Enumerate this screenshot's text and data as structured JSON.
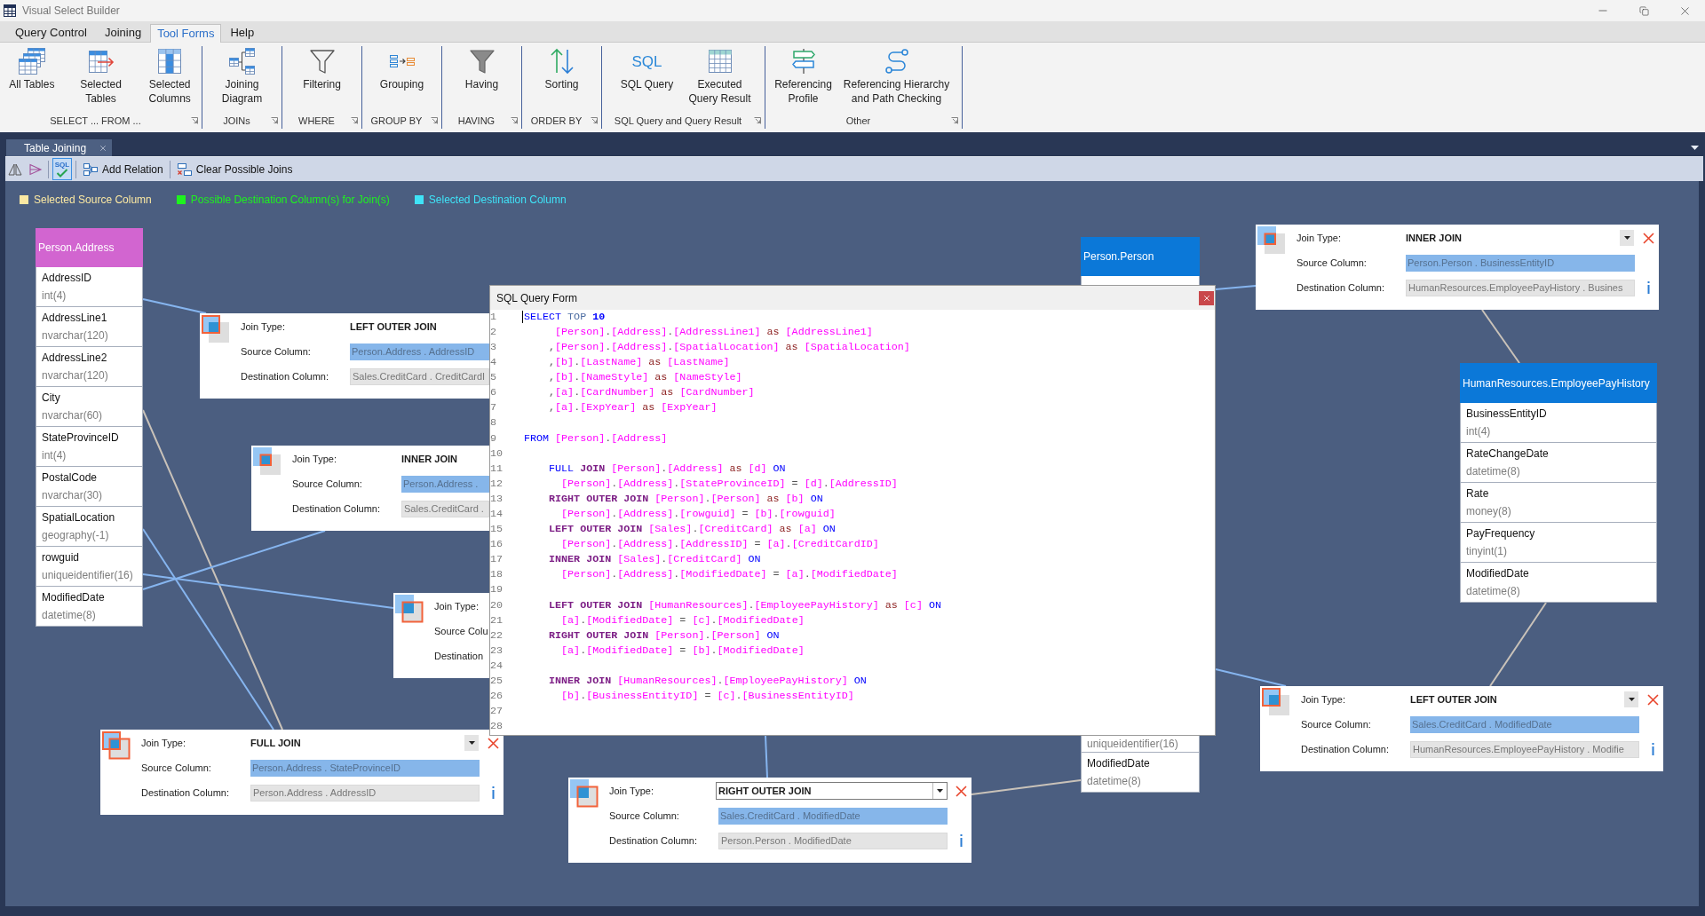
{
  "window": {
    "title": "Visual Select Builder"
  },
  "menu_tabs": [
    {
      "label": "Query Control",
      "selected": false
    },
    {
      "label": "Joining",
      "selected": false
    },
    {
      "label": "Tool Forms",
      "selected": true
    },
    {
      "label": "Help",
      "selected": false
    }
  ],
  "ribbon": [
    {
      "label": "SELECT ... FROM ...",
      "buttons": [
        {
          "kind": "all_tables",
          "label": "All Tables"
        },
        {
          "kind": "selected_tables",
          "label": "Selected Tables"
        },
        {
          "kind": "selected_columns",
          "label": "Selected Columns"
        }
      ]
    },
    {
      "label": "JOINs",
      "buttons": [
        {
          "kind": "joining_diagram",
          "label": "Joining Diagram"
        }
      ]
    },
    {
      "label": "WHERE",
      "buttons": [
        {
          "kind": "filtering",
          "label": "Filtering"
        }
      ]
    },
    {
      "label": "GROUP BY",
      "buttons": [
        {
          "kind": "grouping",
          "label": "Grouping"
        }
      ]
    },
    {
      "label": "HAVING",
      "buttons": [
        {
          "kind": "having",
          "label": "Having"
        }
      ]
    },
    {
      "label": "ORDER BY",
      "buttons": [
        {
          "kind": "sorting",
          "label": "Sorting"
        }
      ]
    },
    {
      "label": "SQL Query and Query Result",
      "buttons": [
        {
          "kind": "sql_query",
          "icon_text": "SQL",
          "label": "SQL Query"
        },
        {
          "kind": "executed_result",
          "label": "Executed Query Result"
        }
      ]
    },
    {
      "label": "Other",
      "buttons": [
        {
          "kind": "referencing_profile",
          "label": "Referencing Profile"
        },
        {
          "kind": "referencing_hierarchy",
          "label": "Referencing Hierarchy and Path Checking"
        }
      ]
    }
  ],
  "document_tab": {
    "label": "Table Joining"
  },
  "toolbar": [
    {
      "kind": "mirror",
      "pressed": false
    },
    {
      "kind": "triangle",
      "pressed": false
    },
    {
      "kind": "sql_check",
      "icon_text": "SQL",
      "pressed": true
    },
    {
      "kind": "add_relation",
      "label": "Add Relation",
      "pressed": false
    },
    {
      "kind": "clear_joins",
      "label": "Clear Possible Joins",
      "pressed": false
    }
  ],
  "legend": [
    {
      "label": "Selected Source Column",
      "color": "#fbe8a2"
    },
    {
      "label": "Possible Destination Column(s) for Join(s)",
      "color": "#1ef21e"
    },
    {
      "label": "Selected Destination Column",
      "color": "#3fe3f7"
    }
  ],
  "tables": [
    {
      "name": "Person.Address",
      "color": "#d265d0",
      "columns": [
        {
          "name": "AddressID",
          "type": "int(4)"
        },
        {
          "name": "AddressLine1",
          "type": "nvarchar(120)"
        },
        {
          "name": "AddressLine2",
          "type": "nvarchar(120)"
        },
        {
          "name": "City",
          "type": "nvarchar(60)"
        },
        {
          "name": "StateProvinceID",
          "type": "int(4)"
        },
        {
          "name": "PostalCode",
          "type": "nvarchar(30)"
        },
        {
          "name": "SpatialLocation",
          "type": "geography(-1)"
        },
        {
          "name": "rowguid",
          "type": "uniqueidentifier(16)"
        },
        {
          "name": "ModifiedDate",
          "type": "datetime(8)"
        }
      ]
    },
    {
      "name": "Person.Person",
      "color": "#0b78d8",
      "columns": [
        {
          "type": "uniqueidentifier(16)"
        },
        {
          "name": "ModifiedDate",
          "type": "datetime(8)"
        }
      ]
    },
    {
      "name": "HumanResources.EmployeePayHistory",
      "color": "#0b78d8",
      "columns": [
        {
          "name": "BusinessEntityID",
          "type": "int(4)"
        },
        {
          "name": "RateChangeDate",
          "type": "datetime(8)"
        },
        {
          "name": "Rate",
          "type": "money(8)"
        },
        {
          "name": "PayFrequency",
          "type": "tinyint(1)"
        },
        {
          "name": "ModifiedDate",
          "type": "datetime(8)"
        }
      ]
    }
  ],
  "join_cards": [
    {
      "kind": "inner",
      "join_type_label": "Join Type:",
      "join_type": "INNER JOIN",
      "focused": false,
      "source_label": "Source Column:",
      "source": "Person.Person . BusinessEntityID",
      "destination_label": "Destination Column:",
      "destination": "HumanResources.EmployeePayHistory . Busines"
    },
    {
      "kind": "left",
      "join_type_label": "Join Type:",
      "join_type": "LEFT OUTER JOIN",
      "source_label": "Source Column:",
      "source": "Person.Address . AddressID",
      "destination_label": "Destination Column:",
      "destination": "Sales.CreditCard . CreditCardI"
    },
    {
      "kind": "inner",
      "join_type_label": "Join Type:",
      "join_type": "INNER JOIN",
      "source_label": "Source Column:",
      "source": "Person.Address .",
      "destination_label": "Destination Column:",
      "destination": "Sales.CreditCard ."
    },
    {
      "kind": "right",
      "join_type_label": "Join Type:",
      "source_label": "Source Colu",
      "destination_label": "Destination"
    },
    {
      "kind": "left",
      "join_type_label": "Join Type:",
      "join_type": "LEFT OUTER JOIN",
      "focused": false,
      "source_label": "Source Column:",
      "source": "Sales.CreditCard . ModifiedDate",
      "destination_label": "Destination Column:",
      "destination": "HumanResources.EmployeePayHistory . Modifie"
    },
    {
      "kind": "full",
      "join_type_label": "Join Type:",
      "join_type": "FULL JOIN",
      "focused": false,
      "source_label": "Source Column:",
      "source": "Person.Address . StateProvinceID",
      "destination_label": "Destination Column:",
      "destination": "Person.Address . AddressID"
    },
    {
      "kind": "right",
      "join_type_label": "Join Type:",
      "join_type": "RIGHT OUTER JOIN",
      "focused": true,
      "source_label": "Source Column:",
      "source": "Sales.CreditCard . ModifiedDate",
      "destination_label": "Destination Column:",
      "destination": "Person.Person . ModifiedDate"
    }
  ],
  "sql_form": {
    "title": "SQL Query Form",
    "lines": [
      {
        "number": "1",
        "tokens": [
          {
            "kind": "keyword",
            "text": "SELECT "
          },
          {
            "kind": "keyword_dim",
            "text": "TOP "
          },
          {
            "kind": "number",
            "text": "10"
          }
        ]
      },
      {
        "number": "2",
        "tokens": [
          {
            "kind": "name",
            "text": "     [Person]"
          },
          {
            "kind": "punct",
            "text": "."
          },
          {
            "kind": "name",
            "text": "[Address]"
          },
          {
            "kind": "punct",
            "text": "."
          },
          {
            "kind": "name",
            "text": "[AddressLine1]"
          },
          {
            "kind": "alias",
            "text": " as "
          },
          {
            "kind": "name",
            "text": "[AddressLine1]"
          }
        ]
      },
      {
        "number": "3",
        "tokens": [
          {
            "kind": "punct",
            "text": "    ,"
          },
          {
            "kind": "name",
            "text": "[Person]"
          },
          {
            "kind": "punct",
            "text": "."
          },
          {
            "kind": "name",
            "text": "[Address]"
          },
          {
            "kind": "punct",
            "text": "."
          },
          {
            "kind": "name",
            "text": "[SpatialLocation]"
          },
          {
            "kind": "alias",
            "text": " as "
          },
          {
            "kind": "name",
            "text": "[SpatialLocation]"
          }
        ]
      },
      {
        "number": "4",
        "tokens": [
          {
            "kind": "punct",
            "text": "    ,"
          },
          {
            "kind": "name",
            "text": "[b]"
          },
          {
            "kind": "punct",
            "text": "."
          },
          {
            "kind": "name",
            "text": "[LastName]"
          },
          {
            "kind": "alias",
            "text": " as "
          },
          {
            "kind": "name",
            "text": "[LastName]"
          }
        ]
      },
      {
        "number": "5",
        "tokens": [
          {
            "kind": "punct",
            "text": "    ,"
          },
          {
            "kind": "name",
            "text": "[b]"
          },
          {
            "kind": "punct",
            "text": "."
          },
          {
            "kind": "name",
            "text": "[NameStyle]"
          },
          {
            "kind": "alias",
            "text": " as "
          },
          {
            "kind": "name",
            "text": "[NameStyle]"
          }
        ]
      },
      {
        "number": "6",
        "tokens": [
          {
            "kind": "punct",
            "text": "    ,"
          },
          {
            "kind": "name",
            "text": "[a]"
          },
          {
            "kind": "punct",
            "text": "."
          },
          {
            "kind": "name",
            "text": "[CardNumber]"
          },
          {
            "kind": "alias",
            "text": " as "
          },
          {
            "kind": "name",
            "text": "[CardNumber]"
          }
        ]
      },
      {
        "number": "7",
        "tokens": [
          {
            "kind": "punct",
            "text": "    ,"
          },
          {
            "kind": "name",
            "text": "[a]"
          },
          {
            "kind": "punct",
            "text": "."
          },
          {
            "kind": "name",
            "text": "[ExpYear]"
          },
          {
            "kind": "alias",
            "text": " as "
          },
          {
            "kind": "name",
            "text": "[ExpYear]"
          }
        ]
      },
      {
        "number": "8"
      },
      {
        "number": "9",
        "tokens": [
          {
            "kind": "keyword",
            "text": "FROM "
          },
          {
            "kind": "name",
            "text": "[Person]"
          },
          {
            "kind": "punct",
            "text": "."
          },
          {
            "kind": "name",
            "text": "[Address]"
          }
        ]
      },
      {
        "number": "10"
      },
      {
        "number": "11",
        "tokens": [
          {
            "kind": "keyword",
            "text": "    FULL "
          },
          {
            "kind": "join",
            "text": "JOIN "
          },
          {
            "kind": "name",
            "text": "[Person]"
          },
          {
            "kind": "punct",
            "text": "."
          },
          {
            "kind": "name",
            "text": "[Address]"
          },
          {
            "kind": "alias",
            "text": " as "
          },
          {
            "kind": "name",
            "text": "[d]"
          },
          {
            "kind": "keyword",
            "text": " ON"
          }
        ]
      },
      {
        "number": "12",
        "tokens": [
          {
            "kind": "name",
            "text": "      [Person]"
          },
          {
            "kind": "punct",
            "text": "."
          },
          {
            "kind": "name",
            "text": "[Address]"
          },
          {
            "kind": "punct",
            "text": "."
          },
          {
            "kind": "name",
            "text": "[StateProvinceID]"
          },
          {
            "kind": "punct",
            "text": " = "
          },
          {
            "kind": "name",
            "text": "[d]"
          },
          {
            "kind": "punct",
            "text": "."
          },
          {
            "kind": "name",
            "text": "[AddressID]"
          }
        ]
      },
      {
        "number": "13",
        "tokens": [
          {
            "kind": "join",
            "text": "    RIGHT OUTER JOIN "
          },
          {
            "kind": "name",
            "text": "[Person]"
          },
          {
            "kind": "punct",
            "text": "."
          },
          {
            "kind": "name",
            "text": "[Person]"
          },
          {
            "kind": "alias",
            "text": " as "
          },
          {
            "kind": "name",
            "text": "[b]"
          },
          {
            "kind": "keyword",
            "text": " ON"
          }
        ]
      },
      {
        "number": "14",
        "tokens": [
          {
            "kind": "name",
            "text": "      [Person]"
          },
          {
            "kind": "punct",
            "text": "."
          },
          {
            "kind": "name",
            "text": "[Address]"
          },
          {
            "kind": "punct",
            "text": "."
          },
          {
            "kind": "name",
            "text": "[rowguid]"
          },
          {
            "kind": "punct",
            "text": " = "
          },
          {
            "kind": "name",
            "text": "[b]"
          },
          {
            "kind": "punct",
            "text": "."
          },
          {
            "kind": "name",
            "text": "[rowguid]"
          }
        ]
      },
      {
        "number": "15",
        "tokens": [
          {
            "kind": "join",
            "text": "    LEFT OUTER JOIN "
          },
          {
            "kind": "name",
            "text": "[Sales]"
          },
          {
            "kind": "punct",
            "text": "."
          },
          {
            "kind": "name",
            "text": "[CreditCard]"
          },
          {
            "kind": "alias",
            "text": " as "
          },
          {
            "kind": "name",
            "text": "[a]"
          },
          {
            "kind": "keyword",
            "text": " ON"
          }
        ]
      },
      {
        "number": "16",
        "tokens": [
          {
            "kind": "name",
            "text": "      [Person]"
          },
          {
            "kind": "punct",
            "text": "."
          },
          {
            "kind": "name",
            "text": "[Address]"
          },
          {
            "kind": "punct",
            "text": "."
          },
          {
            "kind": "name",
            "text": "[AddressID]"
          },
          {
            "kind": "punct",
            "text": " = "
          },
          {
            "kind": "name",
            "text": "[a]"
          },
          {
            "kind": "punct",
            "text": "."
          },
          {
            "kind": "name",
            "text": "[CreditCardID]"
          }
        ]
      },
      {
        "number": "17",
        "tokens": [
          {
            "kind": "join",
            "text": "    INNER JOIN "
          },
          {
            "kind": "name",
            "text": "[Sales]"
          },
          {
            "kind": "punct",
            "text": "."
          },
          {
            "kind": "name",
            "text": "[CreditCard]"
          },
          {
            "kind": "keyword",
            "text": " ON"
          }
        ]
      },
      {
        "number": "18",
        "tokens": [
          {
            "kind": "name",
            "text": "      [Person]"
          },
          {
            "kind": "punct",
            "text": "."
          },
          {
            "kind": "name",
            "text": "[Address]"
          },
          {
            "kind": "punct",
            "text": "."
          },
          {
            "kind": "name",
            "text": "[ModifiedDate]"
          },
          {
            "kind": "punct",
            "text": " = "
          },
          {
            "kind": "name",
            "text": "[a]"
          },
          {
            "kind": "punct",
            "text": "."
          },
          {
            "kind": "name",
            "text": "[ModifiedDate]"
          }
        ]
      },
      {
        "number": "19"
      },
      {
        "number": "20",
        "tokens": [
          {
            "kind": "join",
            "text": "    LEFT OUTER JOIN "
          },
          {
            "kind": "name",
            "text": "[HumanResources]"
          },
          {
            "kind": "punct",
            "text": "."
          },
          {
            "kind": "name",
            "text": "[EmployeePayHistory]"
          },
          {
            "kind": "alias",
            "text": " as "
          },
          {
            "kind": "name",
            "text": "[c]"
          },
          {
            "kind": "keyword",
            "text": " ON"
          }
        ]
      },
      {
        "number": "21",
        "tokens": [
          {
            "kind": "name",
            "text": "      [a]"
          },
          {
            "kind": "punct",
            "text": "."
          },
          {
            "kind": "name",
            "text": "[ModifiedDate]"
          },
          {
            "kind": "punct",
            "text": " = "
          },
          {
            "kind": "name",
            "text": "[c]"
          },
          {
            "kind": "punct",
            "text": "."
          },
          {
            "kind": "name",
            "text": "[ModifiedDate]"
          }
        ]
      },
      {
        "number": "22",
        "tokens": [
          {
            "kind": "join",
            "text": "    RIGHT OUTER JOIN "
          },
          {
            "kind": "name",
            "text": "[Person]"
          },
          {
            "kind": "punct",
            "text": "."
          },
          {
            "kind": "name",
            "text": "[Person]"
          },
          {
            "kind": "keyword",
            "text": " ON"
          }
        ]
      },
      {
        "number": "23",
        "tokens": [
          {
            "kind": "name",
            "text": "      [a]"
          },
          {
            "kind": "punct",
            "text": "."
          },
          {
            "kind": "name",
            "text": "[ModifiedDate]"
          },
          {
            "kind": "punct",
            "text": " = "
          },
          {
            "kind": "name",
            "text": "[b]"
          },
          {
            "kind": "punct",
            "text": "."
          },
          {
            "kind": "name",
            "text": "[ModifiedDate]"
          }
        ]
      },
      {
        "number": "24"
      },
      {
        "number": "25",
        "tokens": [
          {
            "kind": "join",
            "text": "    INNER JOIN "
          },
          {
            "kind": "name",
            "text": "[HumanResources]"
          },
          {
            "kind": "punct",
            "text": "."
          },
          {
            "kind": "name",
            "text": "[EmployeePayHistory]"
          },
          {
            "kind": "keyword",
            "text": " ON"
          }
        ]
      },
      {
        "number": "26",
        "tokens": [
          {
            "kind": "name",
            "text": "      [b]"
          },
          {
            "kind": "punct",
            "text": "."
          },
          {
            "kind": "name",
            "text": "[BusinessEntityID]"
          },
          {
            "kind": "punct",
            "text": " = "
          },
          {
            "kind": "name",
            "text": "[c]"
          },
          {
            "kind": "punct",
            "text": "."
          },
          {
            "kind": "name",
            "text": "[BusinessEntityID]"
          }
        ]
      },
      {
        "number": "27"
      },
      {
        "number": "28"
      }
    ]
  }
}
